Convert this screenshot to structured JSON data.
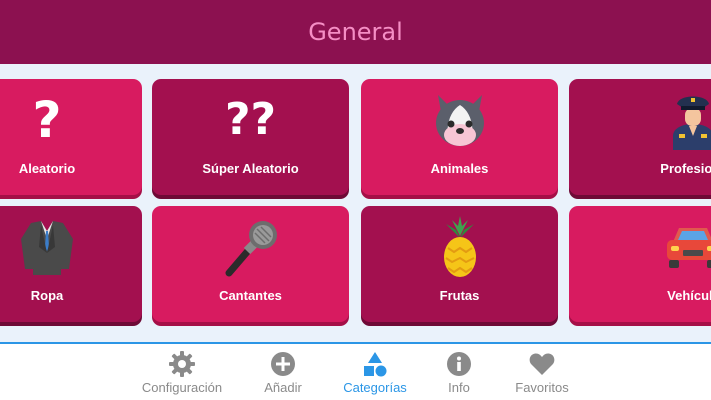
{
  "header": {
    "title": "General"
  },
  "categories": [
    {
      "label": "Aleatorio",
      "icon": "question-mark-icon"
    },
    {
      "label": "Súper Aleatorio",
      "icon": "double-question-mark-icon"
    },
    {
      "label": "Animales",
      "icon": "dog-icon"
    },
    {
      "label": "Profesiones",
      "icon": "police-officer-icon"
    },
    {
      "label": "Ropa",
      "icon": "suit-jacket-icon"
    },
    {
      "label": "Cantantes",
      "icon": "microphone-icon"
    },
    {
      "label": "Frutas",
      "icon": "pineapple-icon"
    },
    {
      "label": "Vehículos",
      "icon": "car-icon"
    }
  ],
  "nav": {
    "items": [
      {
        "label": "Configuración",
        "icon": "gear-icon"
      },
      {
        "label": "Añadir",
        "icon": "plus-circle-icon"
      },
      {
        "label": "Categorías",
        "icon": "shapes-icon",
        "active": true
      },
      {
        "label": "Info",
        "icon": "info-icon"
      },
      {
        "label": "Favoritos",
        "icon": "heart-icon"
      }
    ]
  },
  "colors": {
    "header_bg": "#8c1150",
    "header_text": "#f58ec5",
    "card_primary": "#d81b60",
    "card_dark": "#a3104f",
    "nav_active": "#2b96e6",
    "nav_inactive": "#8a8a8a"
  }
}
